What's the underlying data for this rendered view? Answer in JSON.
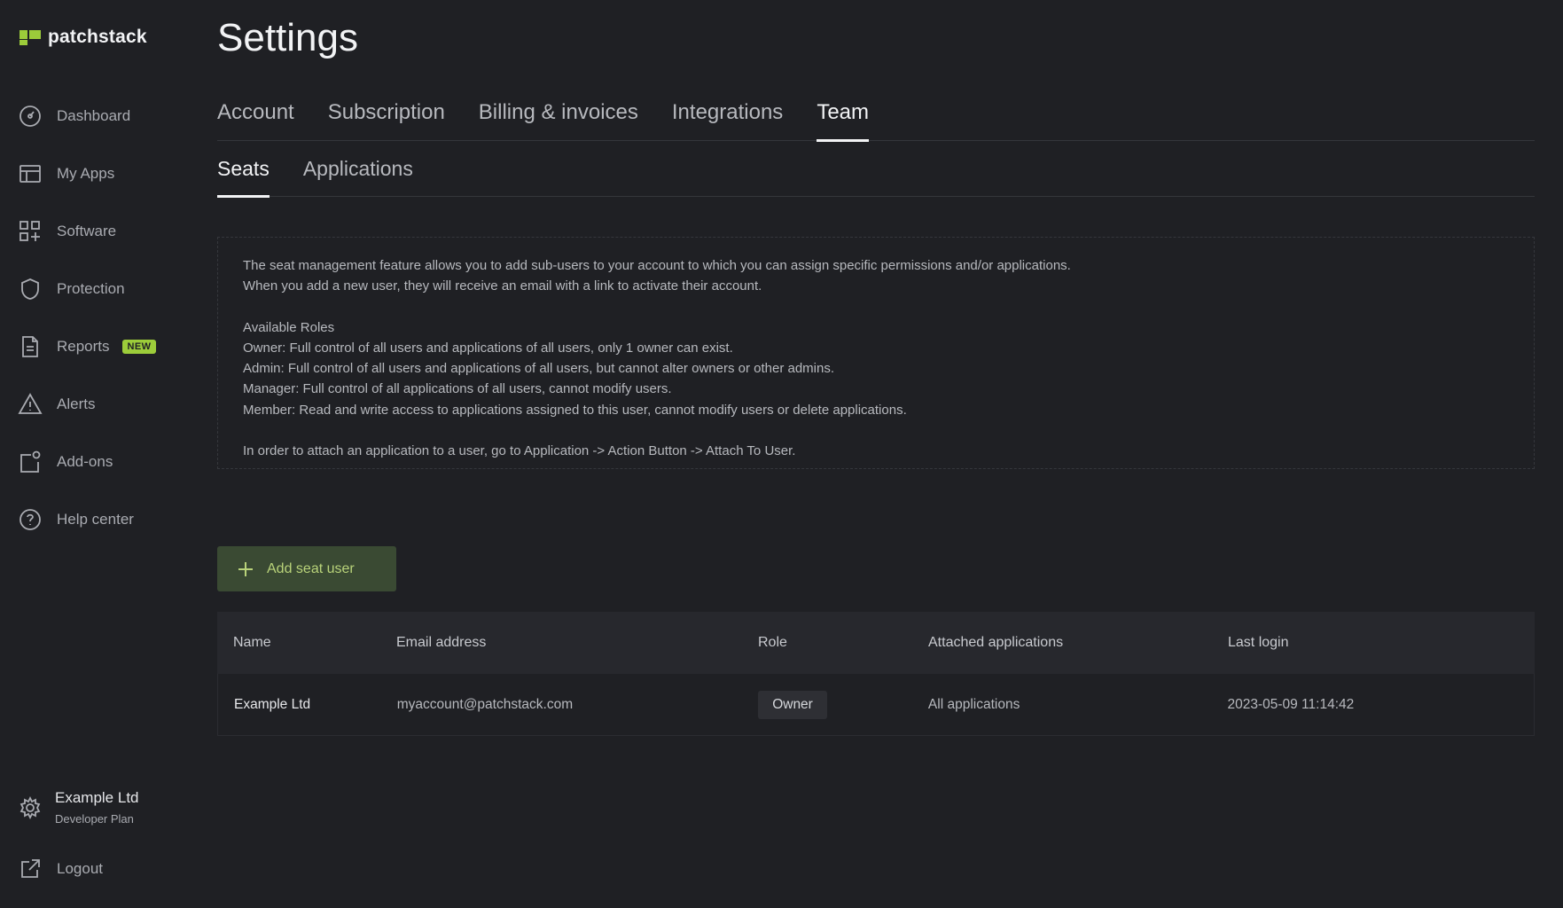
{
  "brand": {
    "name": "patchstack",
    "accent": "#9ccc3a"
  },
  "sidebar": {
    "items": [
      {
        "label": "Dashboard",
        "icon": "gauge-icon"
      },
      {
        "label": "My Apps",
        "icon": "layout-icon"
      },
      {
        "label": "Software",
        "icon": "grid-plus-icon"
      },
      {
        "label": "Protection",
        "icon": "shield-icon"
      },
      {
        "label": "Reports",
        "icon": "document-icon",
        "badge": "NEW"
      },
      {
        "label": "Alerts",
        "icon": "warning-icon"
      },
      {
        "label": "Add-ons",
        "icon": "addon-icon"
      },
      {
        "label": "Help center",
        "icon": "help-icon"
      }
    ],
    "account": {
      "name": "Example Ltd",
      "plan": "Developer Plan",
      "icon": "gear-icon"
    },
    "logout": {
      "label": "Logout",
      "icon": "external-link-icon"
    }
  },
  "page": {
    "title": "Settings"
  },
  "tabs": [
    {
      "label": "Account",
      "active": false
    },
    {
      "label": "Subscription",
      "active": false
    },
    {
      "label": "Billing & invoices",
      "active": false
    },
    {
      "label": "Integrations",
      "active": false
    },
    {
      "label": "Team",
      "active": true
    }
  ],
  "subtabs": [
    {
      "label": "Seats",
      "active": true
    },
    {
      "label": "Applications",
      "active": false
    }
  ],
  "info": {
    "line1": "The seat management feature allows you to add sub-users to your account to which you can assign specific permissions and/or applications.",
    "line2": "When you add a new user, they will receive an email with a link to activate their account.",
    "roles_heading": "Available Roles",
    "role_owner": "Owner: Full control of all users and applications of all users, only 1 owner can exist.",
    "role_admin": "Admin: Full control of all users and applications of all users, but cannot alter owners or other admins.",
    "role_manager": "Manager: Full control of all applications of all users, cannot modify users.",
    "role_member": "Member: Read and write access to applications assigned to this user, cannot modify users or delete applications.",
    "attach_note": "In order to attach an application to a user, go to Application -> Action Button -> Attach To User."
  },
  "actions": {
    "add_seat_user": "Add seat user"
  },
  "table": {
    "headers": [
      "Name",
      "Email address",
      "Role",
      "Attached applications",
      "Last login"
    ],
    "rows": [
      {
        "name": "Example Ltd",
        "email": "myaccount@patchstack.com",
        "role": "Owner",
        "applications": "All applications",
        "last_login": "2023-05-09 11:14:42"
      }
    ]
  }
}
